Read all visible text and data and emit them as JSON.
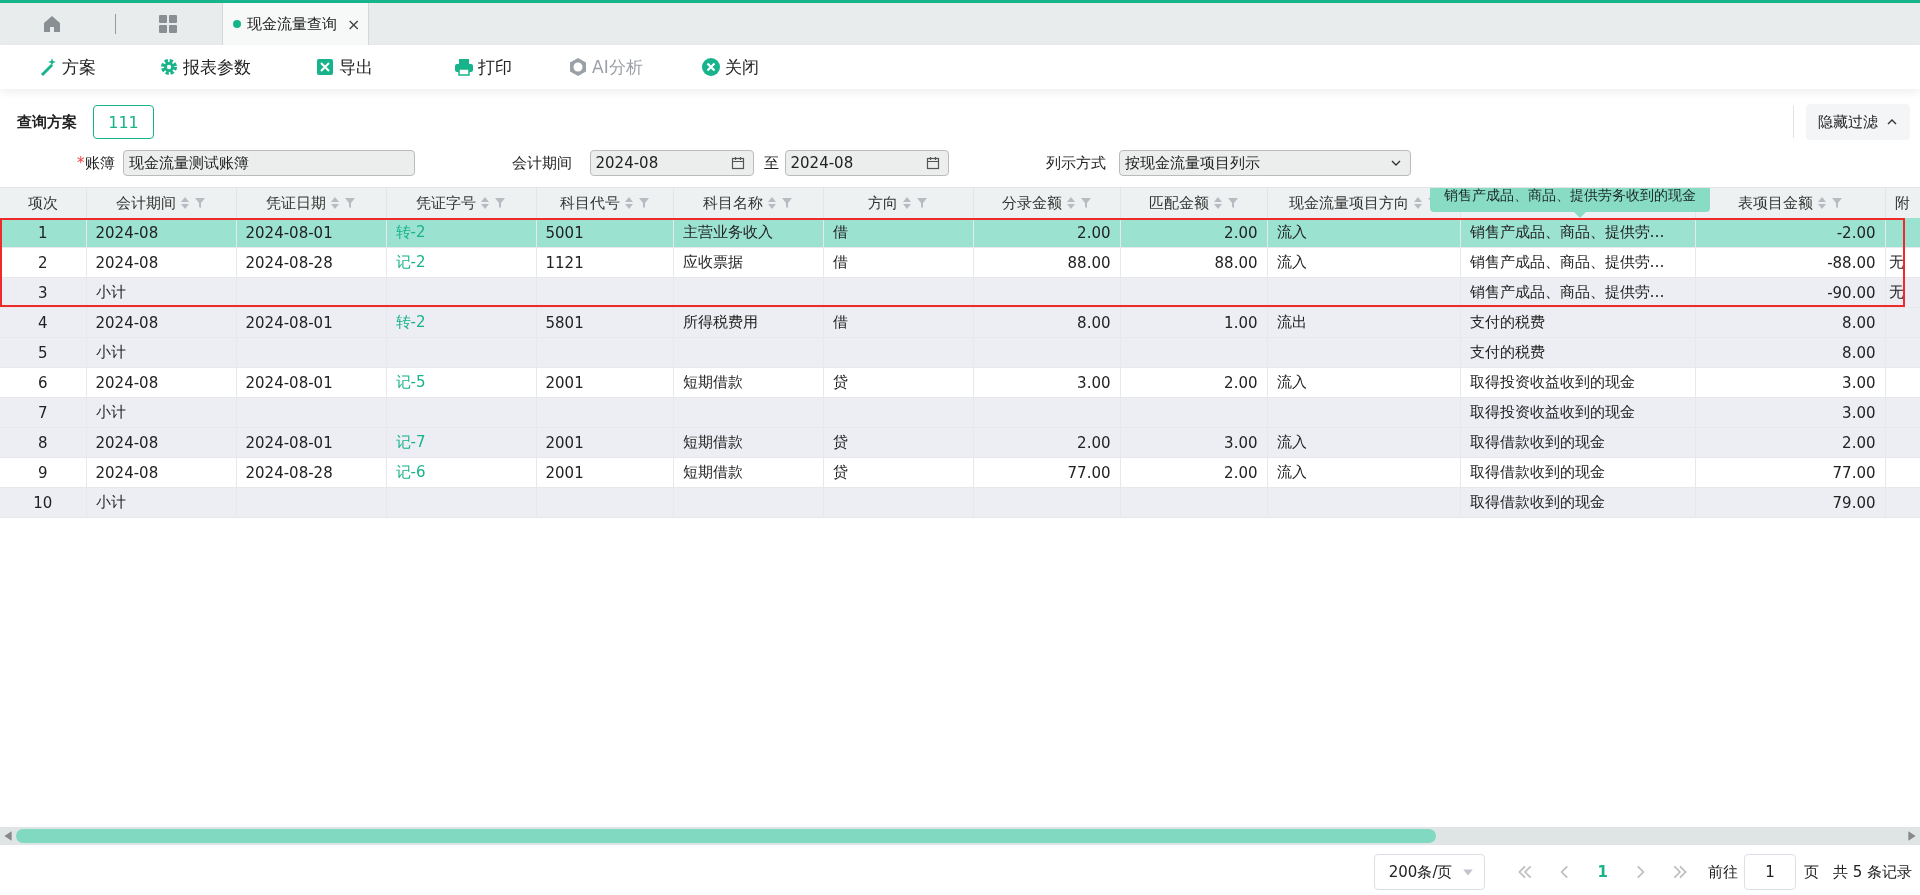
{
  "tabs": [
    {
      "label": "现金流量查询",
      "selected": true,
      "close": "×"
    }
  ],
  "toolbar": [
    {
      "label": "方案",
      "disabled": false
    },
    {
      "label": "报表参数",
      "disabled": false
    },
    {
      "label": "导出",
      "disabled": false
    },
    {
      "label": "打印",
      "disabled": false
    },
    {
      "label": "AI分析",
      "disabled": true
    },
    {
      "label": "关闭",
      "disabled": false
    }
  ],
  "query_scheme": {
    "label": "查询方案",
    "button": "111"
  },
  "hide_filter": "隐藏过滤",
  "filters": {
    "ledger": {
      "required_mark": "*",
      "label": "账簿",
      "value": "现金流量测试账簿"
    },
    "period": {
      "label": "会计期间",
      "from": "2024-08",
      "separator": "至",
      "to": "2024-08"
    },
    "display": {
      "label": "列示方式",
      "value": "按现金流量项目列示"
    }
  },
  "table": {
    "columns": [
      {
        "label": "项次",
        "kind": "index",
        "sortable": false
      },
      {
        "label": "会计期间",
        "kind": "text",
        "sortable": true
      },
      {
        "label": "凭证日期",
        "kind": "text",
        "sortable": true
      },
      {
        "label": "凭证字号",
        "kind": "link",
        "sortable": true
      },
      {
        "label": "科目代号",
        "kind": "text",
        "sortable": true
      },
      {
        "label": "科目名称",
        "kind": "text",
        "sortable": true
      },
      {
        "label": "方向",
        "kind": "text",
        "sortable": true
      },
      {
        "label": "分录金额",
        "kind": "amount",
        "sortable": true
      },
      {
        "label": "匹配金额",
        "kind": "amount",
        "sortable": true
      },
      {
        "label": "现金流量项目方向",
        "kind": "text",
        "sortable": true
      },
      {
        "kind": "text"
      },
      {
        "label": "表项目金额",
        "kind": "amount",
        "sortable": true
      },
      {
        "label": "附",
        "kind": "text",
        "sortable": false
      }
    ],
    "rows": [
      {
        "selected": true,
        "cells": [
          "1",
          "2024-08",
          "2024-08-01",
          "转-2",
          "5001",
          "主营业务收入",
          "借",
          "2.00",
          "2.00",
          "流入",
          "销售产成品、商品、提供劳…",
          "-2.00",
          ""
        ]
      },
      {
        "selected": false,
        "shaded": false,
        "cells": [
          "2",
          "2024-08",
          "2024-08-28",
          "记-2",
          "1121",
          "应收票据",
          "借",
          "88.00",
          "88.00",
          "流入",
          "销售产成品、商品、提供劳…",
          "-88.00",
          "无"
        ]
      },
      {
        "selected": false,
        "shaded": true,
        "cells": [
          "3",
          "小计",
          "",
          "",
          "",
          "",
          "",
          "",
          "",
          "",
          "销售产成品、商品、提供劳…",
          "-90.00",
          "无"
        ]
      },
      {
        "selected": false,
        "shaded": true,
        "cells": [
          "4",
          "2024-08",
          "2024-08-01",
          "转-2",
          "5801",
          "所得税费用",
          "借",
          "8.00",
          "1.00",
          "流出",
          "支付的税费",
          "8.00",
          ""
        ]
      },
      {
        "selected": false,
        "shaded": true,
        "cells": [
          "5",
          "小计",
          "",
          "",
          "",
          "",
          "",
          "",
          "",
          "",
          "支付的税费",
          "8.00",
          ""
        ]
      },
      {
        "selected": false,
        "shaded": false,
        "cells": [
          "6",
          "2024-08",
          "2024-08-01",
          "记-5",
          "2001",
          "短期借款",
          "贷",
          "3.00",
          "2.00",
          "流入",
          "取得投资收益收到的现金",
          "3.00",
          ""
        ]
      },
      {
        "selected": false,
        "shaded": true,
        "cells": [
          "7",
          "小计",
          "",
          "",
          "",
          "",
          "",
          "",
          "",
          "",
          "取得投资收益收到的现金",
          "3.00",
          ""
        ]
      },
      {
        "selected": false,
        "shaded": true,
        "cells": [
          "8",
          "2024-08",
          "2024-08-01",
          "记-7",
          "2001",
          "短期借款",
          "贷",
          "2.00",
          "3.00",
          "流入",
          "取得借款收到的现金",
          "2.00",
          ""
        ]
      },
      {
        "selected": false,
        "shaded": false,
        "cells": [
          "9",
          "2024-08",
          "2024-08-28",
          "记-6",
          "2001",
          "短期借款",
          "贷",
          "77.00",
          "2.00",
          "流入",
          "取得借款收到的现金",
          "77.00",
          ""
        ]
      },
      {
        "selected": false,
        "shaded": true,
        "cells": [
          "10",
          "小计",
          "",
          "",
          "",
          "",
          "",
          "",
          "",
          "",
          "取得借款收到的现金",
          "79.00",
          ""
        ]
      }
    ],
    "tooltip": "销售产成品、商品、提供劳务收到的现金"
  },
  "pagination": {
    "page_size": "200条/页",
    "pages": [
      {
        "label": "1",
        "selected": true
      }
    ],
    "goto_label": "前往",
    "goto_value": "1",
    "page_unit": "页",
    "total": "共 5 条记录"
  }
}
